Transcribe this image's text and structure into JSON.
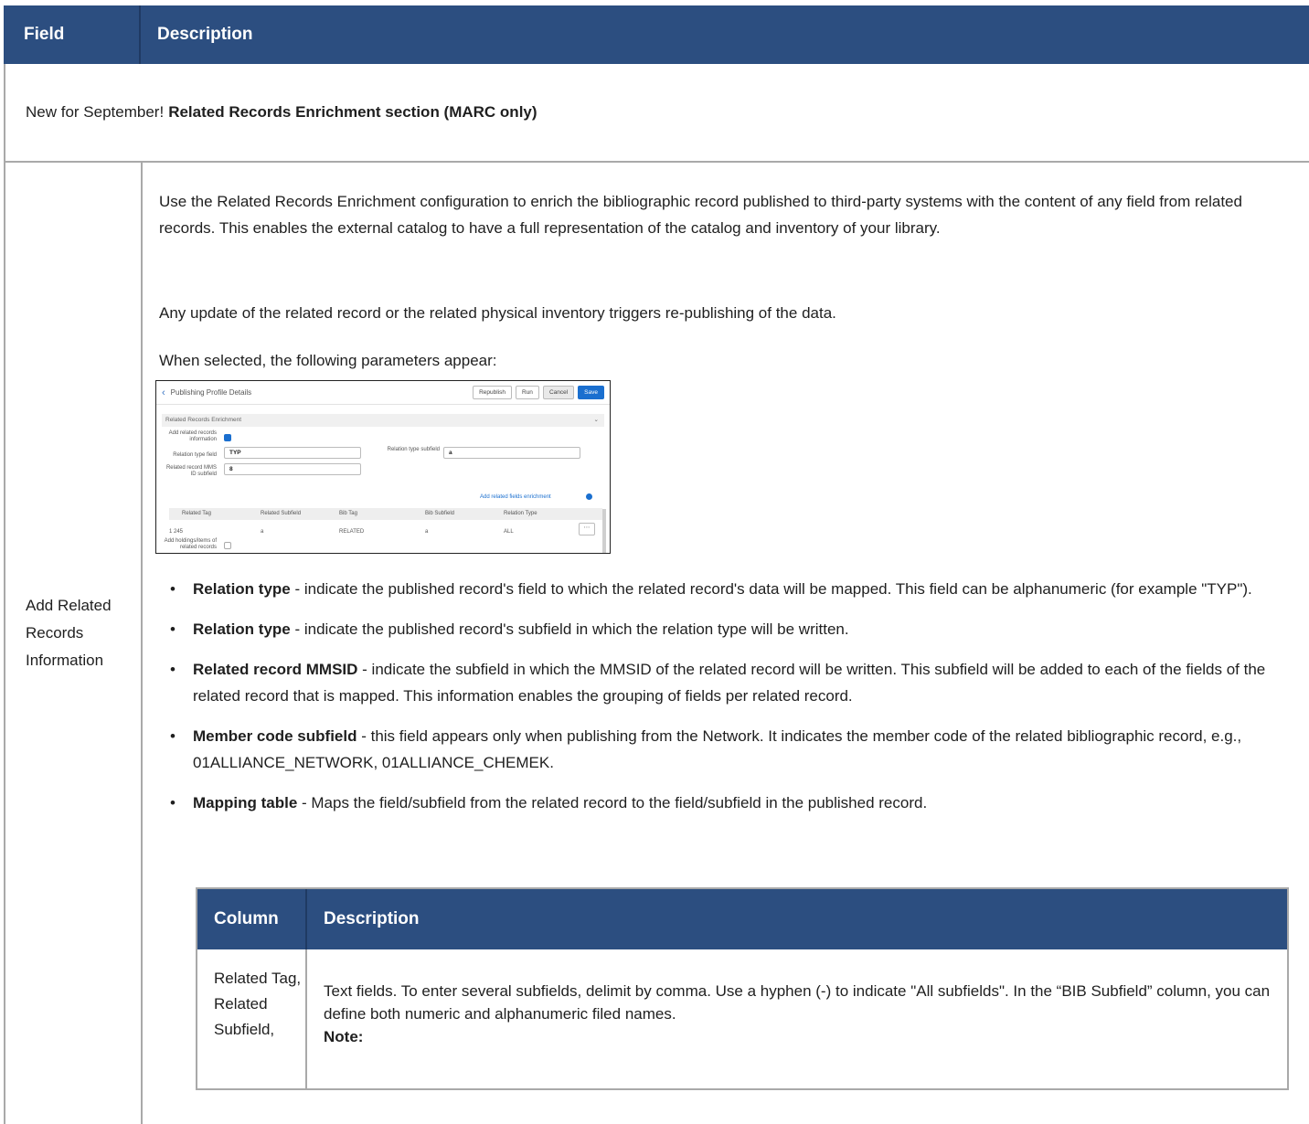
{
  "table": {
    "headers": {
      "field": "Field",
      "description": "Description"
    },
    "new_row": {
      "prefix": "New for September!",
      "bold": "Related Records Enrichment section (MARC only)"
    },
    "main_row": {
      "field_label": "Add Related Records Information",
      "paragraphs": [
        "Use the Related Records Enrichment configuration to enrich the bibliographic record published to third-party systems with the content of any field from related records. This enables the external catalog to have a full representation of the catalog and inventory of your library.",
        "Any update of the related record or the related physical inventory triggers re-publishing of the data.",
        "When selected, the following parameters appear:"
      ],
      "bullets": [
        {
          "term": "Relation type",
          "text": " - indicate the published record's field to which the related record's data will be mapped. This field can be alphanumeric (for example \"TYP\")."
        },
        {
          "term": "Relation type",
          "text": " - indicate the published record's subfield in which the relation type will be written."
        },
        {
          "term": "Related record MMSID",
          "text": " - indicate the subfield in which the MMSID of the related record will be written. This subfield will be added to each of the fields of the related record that is mapped. This information enables the grouping of fields per related record."
        },
        {
          "term": "Member code subfield",
          "text": " - this field appears only when publishing from the Network. It indicates the member code of the related bibliographic record, e.g., 01ALLIANCE_NETWORK,  01ALLIANCE_CHEMEK."
        },
        {
          "term": "Mapping table",
          "text": " - Maps the field/subfield from the related record to the field/subfield in the published record."
        }
      ]
    }
  },
  "screenshot": {
    "title": "Publishing Profile Details",
    "buttons": [
      "Republish",
      "Run",
      "Cancel",
      "Save"
    ],
    "section": "Related Records Enrichment",
    "add_related_label": "Add related records information",
    "relation_type_field_label": "Relation type field",
    "relation_type_field_value": "TYP",
    "relation_type_subfield_label": "Relation type subfield",
    "relation_type_subfield_value": "a",
    "mmsid_label": "Related record MMS ID subfield",
    "mmsid_value": "8",
    "add_link": "Add related fields enrichment",
    "columns": [
      "Related Tag",
      "Related Subfield",
      "Bib Tag",
      "Bib Subfield",
      "Relation Type"
    ],
    "row": [
      "1 245",
      "a",
      "RELATED",
      "a",
      "ALL"
    ],
    "holdings_label": "Add holdings/items of related records"
  },
  "inner_table": {
    "headers": {
      "column": "Column",
      "description": "Description"
    },
    "row": {
      "column": "Related Tag, Related Subfield,",
      "description": "Text fields. To enter several subfields, delimit by comma. Use a hyphen (-) to indicate \"All subfields\". In the “BIB Subfield” column, you can define both numeric and alphanumeric filed names.",
      "note": "Note:"
    }
  }
}
